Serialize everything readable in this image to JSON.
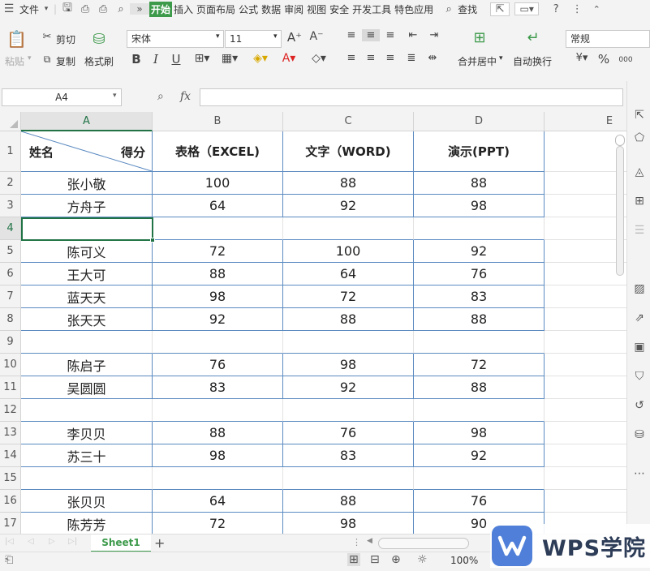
{
  "menubar": {
    "file": "文件",
    "tabs": [
      "开始",
      "插入",
      "页面布局",
      "公式",
      "数据",
      "审阅",
      "视图",
      "安全",
      "开发工具",
      "特色应用"
    ],
    "active_tab": "开始",
    "search": "查找"
  },
  "ribbon": {
    "paste": "粘贴",
    "cut": "剪切",
    "copy": "复制",
    "format_painter": "格式刷",
    "font_name": "宋体",
    "font_size": "11",
    "bold": "B",
    "italic": "I",
    "underline": "U",
    "merge_center": "合并居中",
    "wrap_text": "自动换行",
    "number_format": "常规",
    "percent": "%",
    "thousands": "000"
  },
  "formula_bar": {
    "name_box": "A4",
    "fx": "fx",
    "value": ""
  },
  "columns": [
    "A",
    "B",
    "C",
    "D",
    "E"
  ],
  "header_row": {
    "row_num": "1",
    "a_left": "姓名",
    "a_right": "得分",
    "b": "表格（EXCEL)",
    "c": "文字（WORD)",
    "d": "演示(PPT)"
  },
  "rows": [
    {
      "num": "2",
      "name": "张小敬",
      "excel": "100",
      "word": "88",
      "ppt": "88"
    },
    {
      "num": "3",
      "name": "方舟子",
      "excel": "64",
      "word": "92",
      "ppt": "98"
    },
    {
      "num": "4",
      "name": "",
      "excel": "",
      "word": "",
      "ppt": ""
    },
    {
      "num": "5",
      "name": "陈可义",
      "excel": "72",
      "word": "100",
      "ppt": "92"
    },
    {
      "num": "6",
      "name": "王大可",
      "excel": "88",
      "word": "64",
      "ppt": "76"
    },
    {
      "num": "7",
      "name": "蓝天天",
      "excel": "98",
      "word": "72",
      "ppt": "83"
    },
    {
      "num": "8",
      "name": "张天天",
      "excel": "92",
      "word": "88",
      "ppt": "88"
    },
    {
      "num": "9",
      "name": "",
      "excel": "",
      "word": "",
      "ppt": ""
    },
    {
      "num": "10",
      "name": "陈启子",
      "excel": "76",
      "word": "98",
      "ppt": "72"
    },
    {
      "num": "11",
      "name": "吴圆圆",
      "excel": "83",
      "word": "92",
      "ppt": "88"
    },
    {
      "num": "12",
      "name": "",
      "excel": "",
      "word": "",
      "ppt": ""
    },
    {
      "num": "13",
      "name": "李贝贝",
      "excel": "88",
      "word": "76",
      "ppt": "98"
    },
    {
      "num": "14",
      "name": "苏三十",
      "excel": "98",
      "word": "83",
      "ppt": "92"
    },
    {
      "num": "15",
      "name": "",
      "excel": "",
      "word": "",
      "ppt": ""
    },
    {
      "num": "16",
      "name": "张贝贝",
      "excel": "64",
      "word": "88",
      "ppt": "76"
    },
    {
      "num": "17",
      "name": "陈芳芳",
      "excel": "72",
      "word": "98",
      "ppt": "90"
    }
  ],
  "sheet_tab": "Sheet1",
  "status": {
    "zoom": "100%"
  },
  "watermark": {
    "brand": "WPS学院"
  },
  "colors": {
    "accent_green": "#3d9a4b",
    "table_border": "#5b8ac0",
    "selection": "#217346"
  }
}
